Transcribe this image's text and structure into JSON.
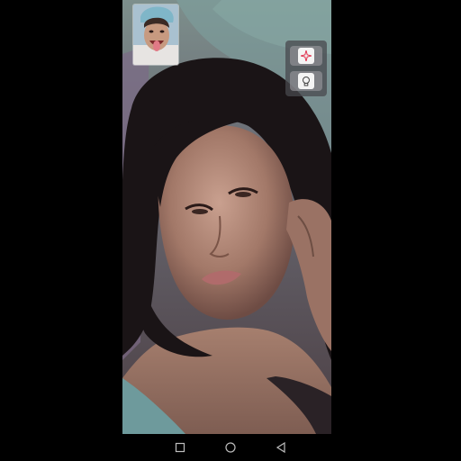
{
  "screen": {
    "app": "video-call"
  },
  "remote_video": {
    "description_icon": "remote-participant-video"
  },
  "self_view": {
    "icon": "self-camera-preview"
  },
  "controls": [
    {
      "icon": "sparkle-effects-icon",
      "accent": "#e0334f"
    },
    {
      "icon": "lightbulb-icon",
      "accent": "#444444"
    }
  ],
  "nav": {
    "back": "triangle-back-icon",
    "home": "circle-home-icon",
    "recents": "square-recents-icon"
  },
  "colors": {
    "background": "#000000",
    "panel": "#48484e"
  }
}
